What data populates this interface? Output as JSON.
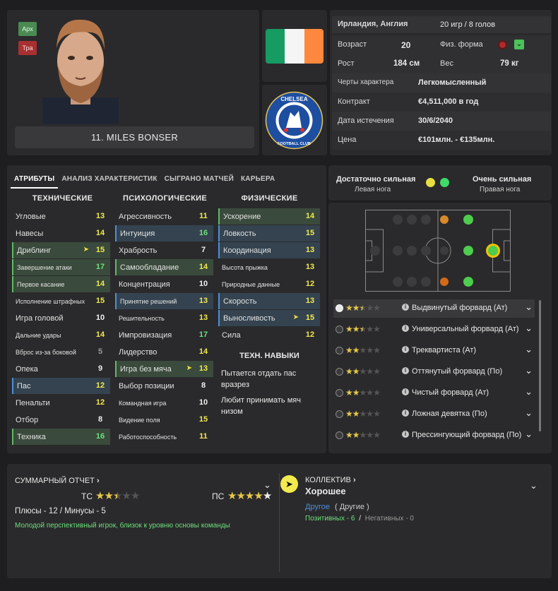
{
  "player": {
    "name": "11. MILES BONSER",
    "tag_top": "Арх",
    "tag_bottom": "Тра"
  },
  "info": {
    "nationality": "Ирландия, Англия",
    "apps_goals": "20 игр / 8 голов",
    "age_label": "Возраст",
    "age": "20",
    "fitness_label": "Физ. форма",
    "height_label": "Рост",
    "height": "184 см",
    "weight_label": "Вес",
    "weight": "79 кг",
    "traits_label": "Черты характера",
    "traits": "Легкомысленный",
    "contract_label": "Контракт",
    "contract": "€4,511,000 в год",
    "expiry_label": "Дата истечения",
    "expiry": "30/6/2040",
    "price_label": "Цена",
    "price": "€101млн. - €135млн."
  },
  "club_crest_text": "CHELSEA FOOTBALL CLUB",
  "tabs": [
    "АТРИБУТЫ",
    "АНАЛИЗ ХАРАКТЕРИСТИК",
    "СЫГРАНО МАТЧЕЙ",
    "КАРЬЕРА"
  ],
  "attributes": {
    "technical_title": "ТЕХНИЧЕСКИЕ",
    "mental_title": "ПСИХОЛОГИЧЕСКИЕ",
    "physical_title": "ФИЗИЧЕСКИЕ",
    "technical": [
      {
        "name": "Угловые",
        "value": "13"
      },
      {
        "name": "Навесы",
        "value": "14"
      },
      {
        "name": "Дриблинг",
        "value": "15"
      },
      {
        "name": "Завершение атаки",
        "value": "17"
      },
      {
        "name": "Первое касание",
        "value": "14"
      },
      {
        "name": "Исполнение штрафных",
        "value": "15"
      },
      {
        "name": "Игра головой",
        "value": "10"
      },
      {
        "name": "Дальние удары",
        "value": "14"
      },
      {
        "name": "Вброс из-за боковой",
        "value": "5"
      },
      {
        "name": "Опека",
        "value": "9"
      },
      {
        "name": "Пас",
        "value": "12"
      },
      {
        "name": "Пенальти",
        "value": "12"
      },
      {
        "name": "Отбор",
        "value": "8"
      },
      {
        "name": "Техника",
        "value": "16"
      }
    ],
    "mental": [
      {
        "name": "Агрессивность",
        "value": "11"
      },
      {
        "name": "Интуиция",
        "value": "16"
      },
      {
        "name": "Храбрость",
        "value": "7"
      },
      {
        "name": "Самообладание",
        "value": "14"
      },
      {
        "name": "Концентрация",
        "value": "10"
      },
      {
        "name": "Принятие решений",
        "value": "13"
      },
      {
        "name": "Решительность",
        "value": "13"
      },
      {
        "name": "Импровизация",
        "value": "17"
      },
      {
        "name": "Лидерство",
        "value": "14"
      },
      {
        "name": "Игра без мяча",
        "value": "13"
      },
      {
        "name": "Выбор позиции",
        "value": "8"
      },
      {
        "name": "Командная игра",
        "value": "10"
      },
      {
        "name": "Видение поля",
        "value": "15"
      },
      {
        "name": "Работоспособность",
        "value": "11"
      }
    ],
    "physical": [
      {
        "name": "Ускорение",
        "value": "14"
      },
      {
        "name": "Ловкость",
        "value": "15"
      },
      {
        "name": "Координация",
        "value": "13"
      },
      {
        "name": "Высота прыжка",
        "value": "13"
      },
      {
        "name": "Природные данные",
        "value": "12"
      },
      {
        "name": "Скорость",
        "value": "13"
      },
      {
        "name": "Выносливость",
        "value": "15"
      },
      {
        "name": "Сила",
        "value": "12"
      }
    ],
    "skills_title": "ТЕХН. НАВЫКИ",
    "skills": [
      "Пытается отдать пас вразрез",
      "Любит принимать мяч низом"
    ]
  },
  "feet": {
    "left_strength": "Достаточно сильная",
    "left_label": "Левая нога",
    "right_strength": "Очень сильная",
    "right_label": "Правая нога",
    "left_color": "#e8e040",
    "right_color": "#3fdc6a"
  },
  "roles": [
    {
      "name": "Выдвинутый форвард (Ат)",
      "stars": 2.5
    },
    {
      "name": "Универсальный форвард (Ат)",
      "stars": 2.5
    },
    {
      "name": "Треквартиста (Ат)",
      "stars": 2
    },
    {
      "name": "Оттянутый форвард (По)",
      "stars": 2
    },
    {
      "name": "Чистый форвард (Ат)",
      "stars": 2
    },
    {
      "name": "Ложная девятка (По)",
      "stars": 2
    },
    {
      "name": "Прессингующий форвард (По)",
      "stars": 2
    }
  ],
  "report": {
    "title": "СУММАРНЫЙ ОТЧЕТ",
    "ca_label": "ТС",
    "ca_stars": 2.5,
    "pa_label": "ПС",
    "pa_stars": 4.5,
    "pros_cons": "Плюсы - 12 / Минусы - 5",
    "summary": "Молодой перспективный игрок, близок к уровню основы команды"
  },
  "squad": {
    "title": "КОЛЛЕКТИВ",
    "status": "Хорошее",
    "group": "Другое",
    "group_sub": "( Другие )",
    "positive": "Позитивных - 6",
    "separator": "/",
    "negative": "Негативных - 0"
  },
  "colors": {
    "green": "#6de07a",
    "yellow": "#f2e94e",
    "blue": "#4d8fd8",
    "chelsea": "#1d4ea0"
  }
}
